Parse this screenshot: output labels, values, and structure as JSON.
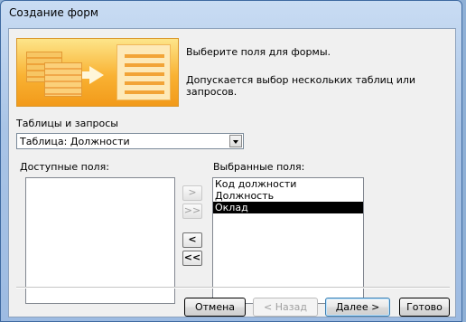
{
  "window": {
    "title": "Создание форм"
  },
  "header": {
    "line1": "Выберите поля для формы.",
    "line2": "Допускается выбор нескольких таблиц или запросов."
  },
  "tables": {
    "label": "Таблицы и запросы",
    "selected": "Таблица: Должности"
  },
  "available": {
    "label": "Доступные поля:",
    "items": []
  },
  "selected_fields": {
    "label": "Выбранные поля:",
    "items": [
      "Код должности",
      "Должность",
      "Оклад"
    ],
    "highlighted_index": 2
  },
  "move_buttons": {
    "add_one": ">",
    "add_all": ">>",
    "remove_one": "<",
    "remove_all": "<<"
  },
  "footer": {
    "cancel": "Отмена",
    "back": "< Назад",
    "next": "Далее >",
    "finish": "Готово"
  }
}
